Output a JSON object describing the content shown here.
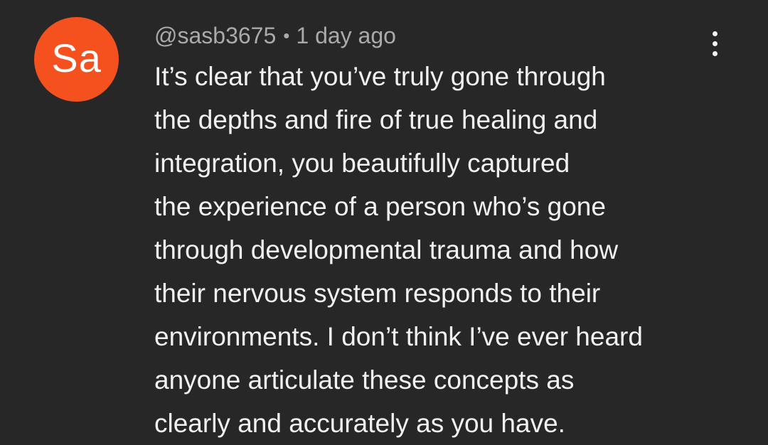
{
  "comment": {
    "avatar": {
      "initials": "Sa",
      "color": "#f4511e"
    },
    "author": "@sasb3675",
    "separator": "•",
    "timestamp": "1 day ago",
    "menu_icon": "more-vertical-icon",
    "text_lines": [
      "It’s clear that you’ve truly gone through",
      "the depths and fire of true healing and",
      "integration, you beautifully captured",
      "the experience of a person who’s gone",
      "through developmental trauma and how",
      "their nervous system responds to their",
      "environments. I don’t think I’ve ever heard",
      "anyone articulate these concepts as",
      "clearly and accurately as you have."
    ]
  },
  "colors": {
    "background": "#272727",
    "primary_text": "#f1f1f1",
    "secondary_text": "#aaaaaa"
  }
}
